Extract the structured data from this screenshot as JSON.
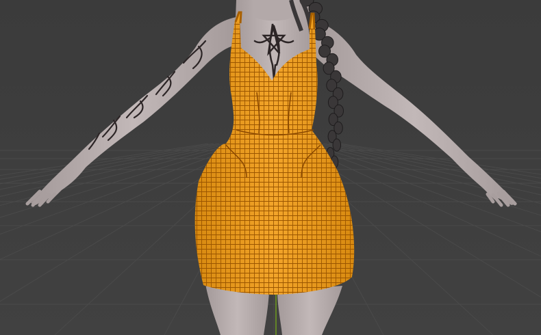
{
  "viewport": {
    "background": "#3d3d3d",
    "grid_line_color": "#4a4a4a",
    "axis_y_color": "#6f9c1f"
  },
  "scene": {
    "figure": {
      "skin_color": "#bdb3b3",
      "skin_shadow": "#8e8585",
      "hair_color": "#3a3738",
      "tattoo_color": "#2c2526"
    },
    "dress": {
      "selected": true,
      "wire_color": "#a85f00",
      "fill_color": "#f0a020"
    }
  }
}
